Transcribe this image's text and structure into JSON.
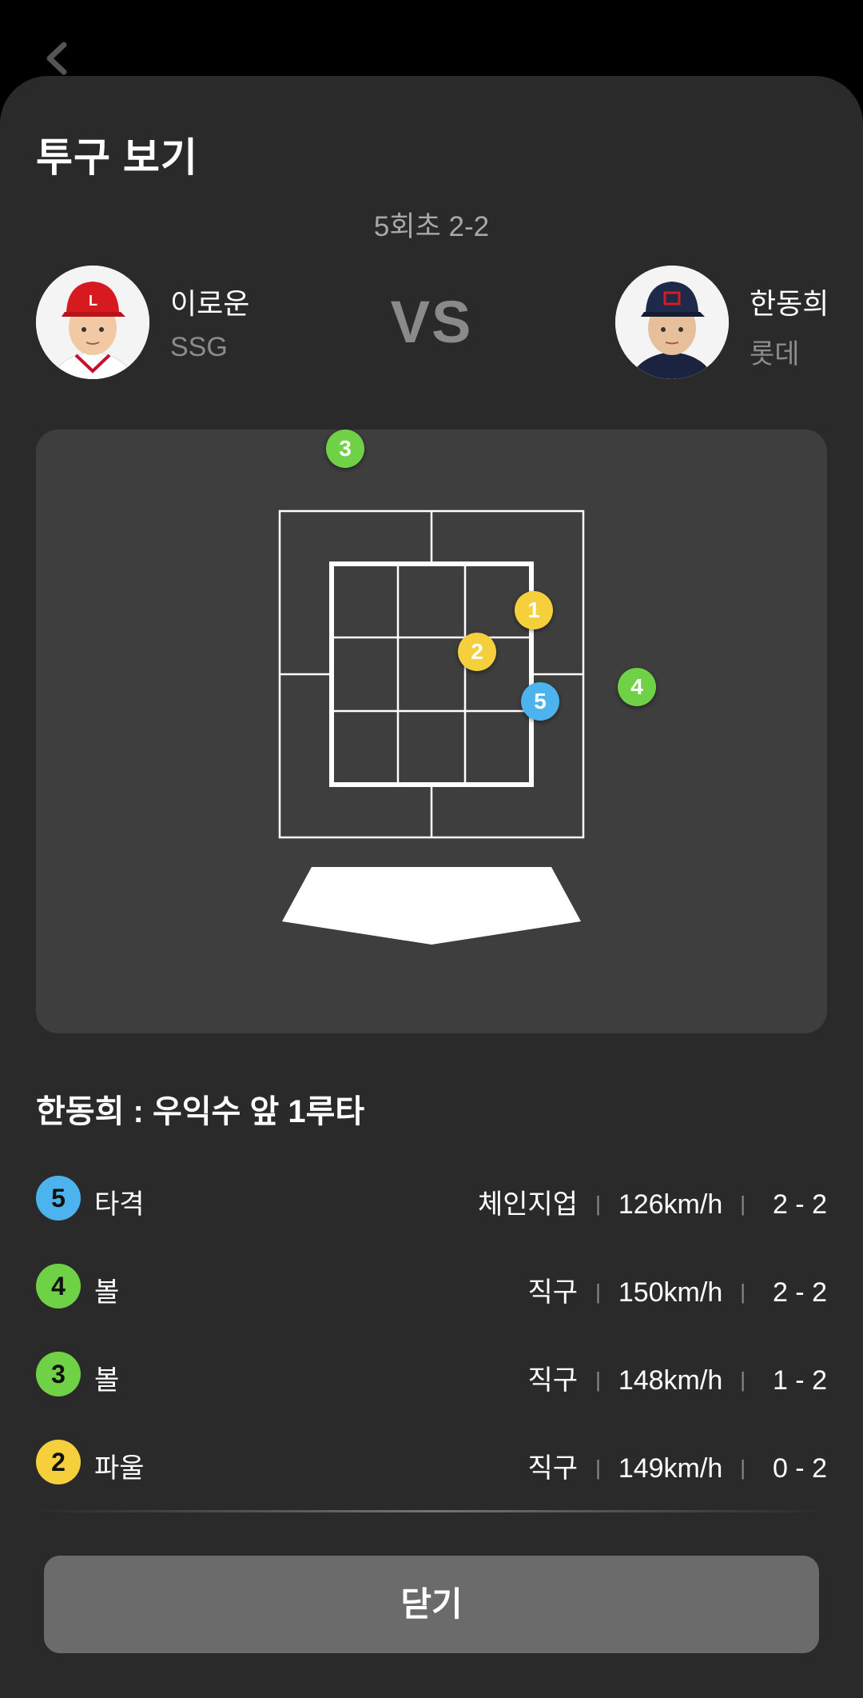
{
  "header": {
    "title": "투구 보기",
    "inning": "5회초 2-2",
    "vs": "VS"
  },
  "pitcher": {
    "name": "이로운",
    "team": "SSG"
  },
  "batter": {
    "name": "한동희",
    "team": "롯데"
  },
  "zone": {
    "markers": [
      {
        "number": "3",
        "type": "ball"
      },
      {
        "number": "1",
        "type": "strike"
      },
      {
        "number": "2",
        "type": "foul"
      },
      {
        "number": "5",
        "type": "hit"
      },
      {
        "number": "4",
        "type": "ball"
      }
    ]
  },
  "colors": {
    "ball": "#6fd145",
    "strike": "#f5cf3c",
    "foul": "#f5cf3c",
    "hit": "#4db3ee"
  },
  "result_title": "한동희 : 우익수 앞 1루타",
  "pitches": [
    {
      "number": "5",
      "result": "타격",
      "pitch_type": "체인지업",
      "speed": "126km/h",
      "count": "2 - 2"
    },
    {
      "number": "4",
      "result": "볼",
      "pitch_type": "직구",
      "speed": "150km/h",
      "count": "2 - 2"
    },
    {
      "number": "3",
      "result": "볼",
      "pitch_type": "직구",
      "speed": "148km/h",
      "count": "1 - 2"
    },
    {
      "number": "2",
      "result": "파울",
      "pitch_type": "직구",
      "speed": "149km/h",
      "count": "0 - 2"
    }
  ],
  "close_label": "닫기"
}
